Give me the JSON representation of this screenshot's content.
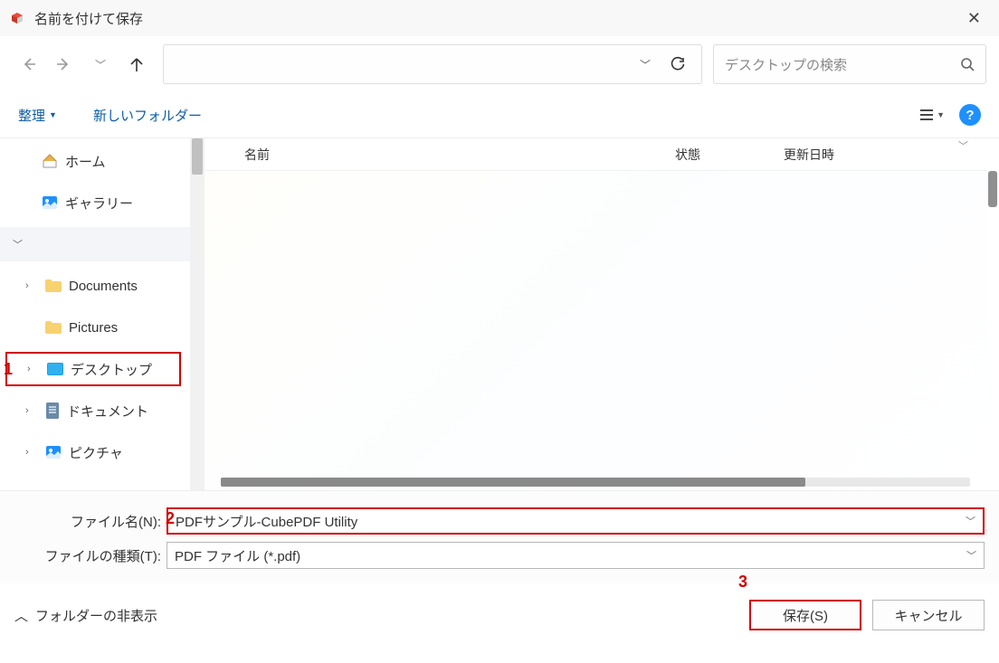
{
  "window": {
    "title": "名前を付けて保存"
  },
  "search": {
    "placeholder": "デスクトップの検索"
  },
  "toolbar": {
    "organize": "整理",
    "new_folder": "新しいフォルダー"
  },
  "sidebar": {
    "home": "ホーム",
    "gallery": "ギャラリー",
    "documents": "Documents",
    "pictures": "Pictures",
    "desktop": "デスクトップ",
    "document_jp": "ドキュメント",
    "picture_jp": "ピクチャ"
  },
  "columns": {
    "name": "名前",
    "status": "状態",
    "modified": "更新日時"
  },
  "fields": {
    "filename_label": "ファイル名(N):",
    "filename_value": "PDFサンプル-CubePDF Utility",
    "filetype_label": "ファイルの種類(T):",
    "filetype_value": "PDF ファイル (*.pdf)"
  },
  "footer": {
    "hide_folders": "フォルダーの非表示",
    "save": "保存(S)",
    "cancel": "キャンセル"
  },
  "annotations": {
    "a1": "1",
    "a2": "2",
    "a3": "3"
  }
}
